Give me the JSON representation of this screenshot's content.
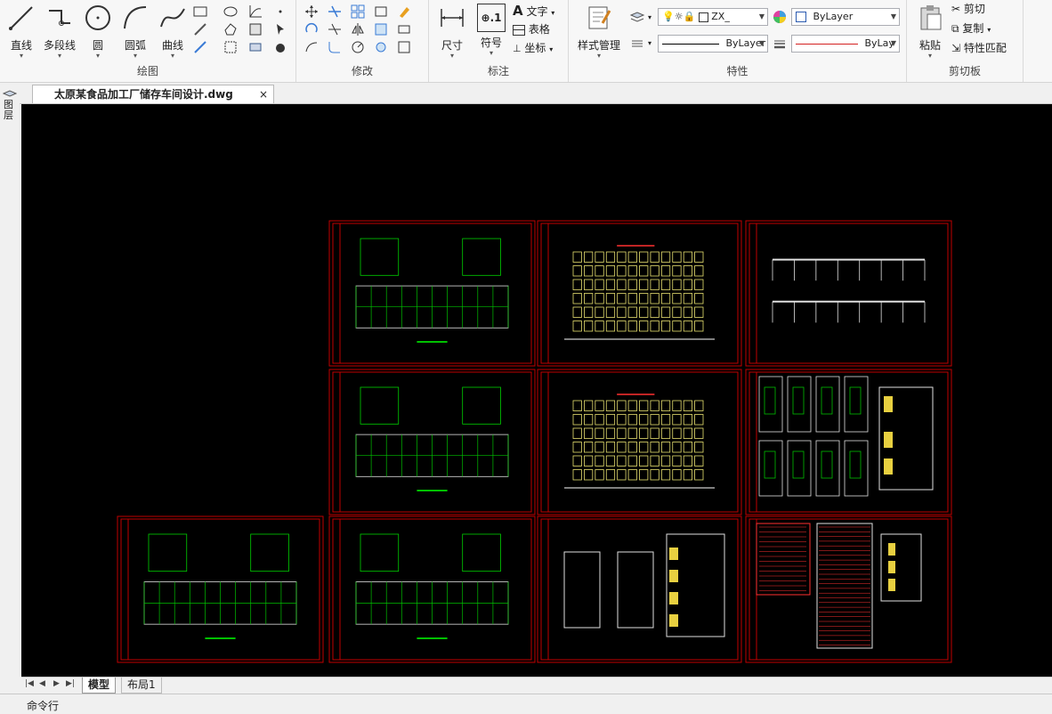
{
  "ribbon": {
    "draw": {
      "label": "绘图",
      "line": "直线",
      "polyline": "多段线",
      "circle": "圆",
      "arc": "圆弧",
      "curve": "曲线"
    },
    "modify": {
      "label": "修改"
    },
    "annotate": {
      "label": "标注",
      "dimension": "尺寸",
      "symbol": "符号",
      "symbol_glyph": "⊕.1",
      "text": "文字",
      "table": "表格",
      "coord": "坐标"
    },
    "properties": {
      "label": "特性",
      "style_manager": "样式管理",
      "layer_value": "ZX_",
      "color_value": "ByLayer",
      "linetype_value": "ByLayer",
      "lineweight_value": "ByLay"
    },
    "clipboard": {
      "label": "剪切板",
      "paste": "粘贴",
      "cut": "剪切",
      "copy": "复制",
      "match": "特性匹配"
    }
  },
  "document": {
    "tab_title": "太原某食品加工厂储存车间设计.dwg",
    "close_glyph": "×"
  },
  "side_panel": {
    "label": "图层"
  },
  "layouts": {
    "nav": [
      "|◀",
      "◀",
      "▶",
      "▶|"
    ],
    "tabs": [
      "模型",
      "布局1"
    ]
  },
  "command": {
    "label": "命令行"
  },
  "colors": {
    "canvas": "#000000",
    "frame": "#c00000",
    "accent_red": "#ff3030",
    "byLayer_line_red": "#d42020"
  }
}
